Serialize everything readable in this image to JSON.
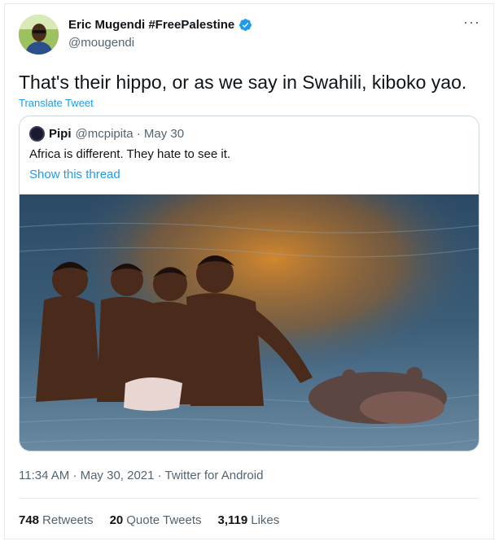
{
  "author": {
    "name": "Eric Mugendi #FreePalestine",
    "handle": "@mougendi",
    "verified": true
  },
  "tweet": {
    "text": "That's their hippo, or as we say in Swahili, kiboko yao.",
    "translate_label": "Translate Tweet"
  },
  "quoted": {
    "name": "Pipi",
    "meta": "@mcpipita · May 30",
    "text": "Africa is different. They hate to see it.",
    "thread_link": "Show this thread"
  },
  "footer": {
    "timestamp": "11:34 AM · May 30, 2021 · Twitter for Android"
  },
  "stats": {
    "retweets_count": "748",
    "retweets_label": "Retweets",
    "quotes_count": "20",
    "quotes_label": "Quote Tweets",
    "likes_count": "3,119",
    "likes_label": "Likes"
  },
  "colors": {
    "accent": "#1d9bf0",
    "text": "#0f1419",
    "muted": "#536471",
    "border": "#cfd9de"
  },
  "icons": {
    "verified": "verified-badge-icon",
    "more": "more-options-icon"
  }
}
